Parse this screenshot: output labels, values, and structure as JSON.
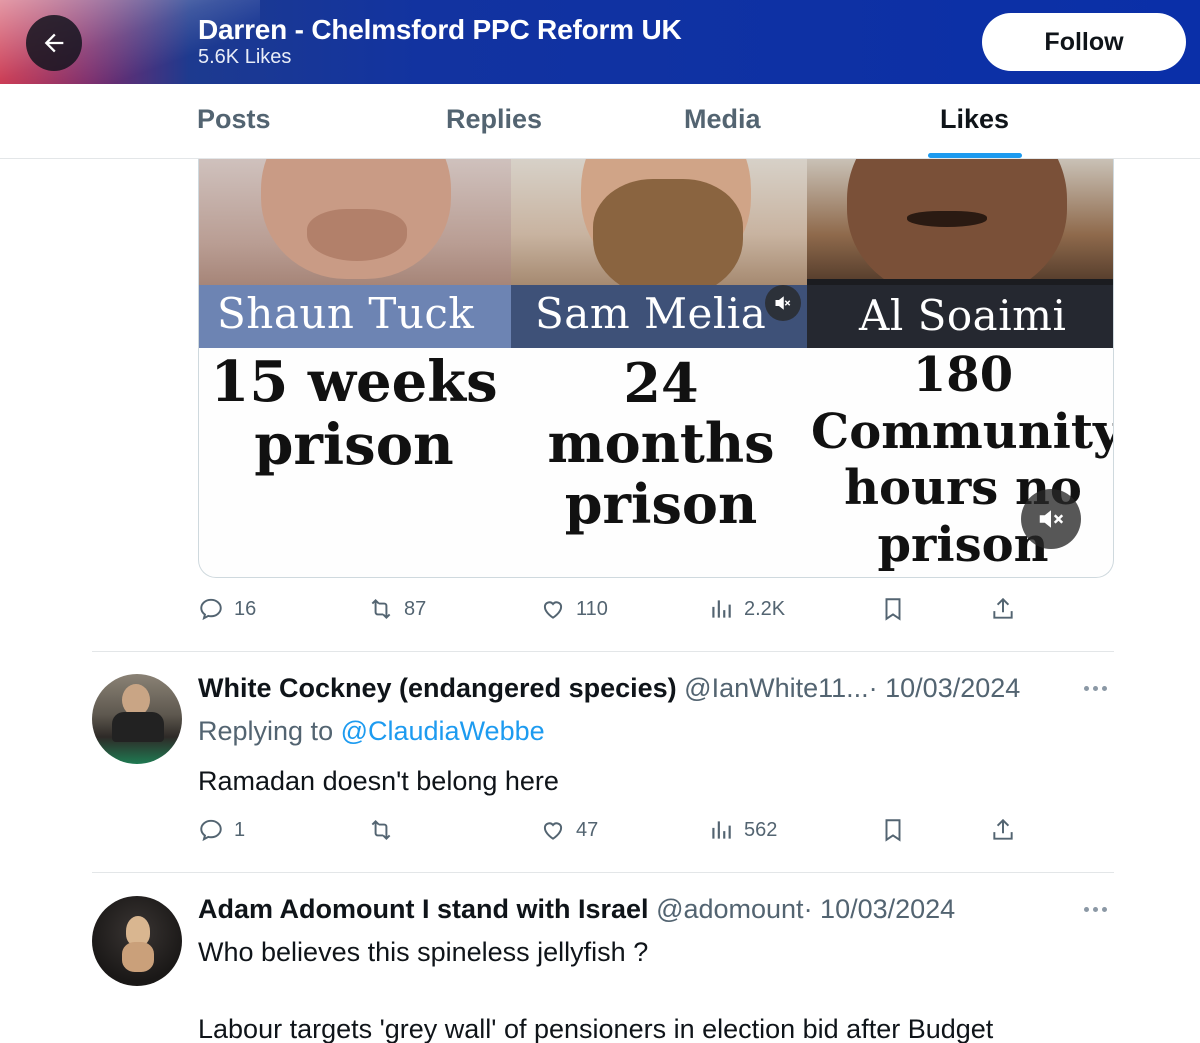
{
  "header": {
    "title": "Darren - Chelmsford PPC Reform UK",
    "subtitle": "5.6K Likes",
    "follow_label": "Follow",
    "back_icon": "arrow-left-icon"
  },
  "tabs": [
    {
      "label": "Posts",
      "active": false
    },
    {
      "label": "Replies",
      "active": false
    },
    {
      "label": "Media",
      "active": false
    },
    {
      "label": "Likes",
      "active": true
    }
  ],
  "media_card": {
    "columns": [
      {
        "name": "Shaun Tuck",
        "name_color": "#ffffff",
        "sentence": [
          "15 weeks",
          "prison"
        ]
      },
      {
        "name": "Sam Melia",
        "name_color": "#ffffff",
        "sentence": [
          "24 months",
          "prison"
        ]
      },
      {
        "name": "Al Soaimi",
        "name_color": "#ffffff",
        "sentence": [
          "180",
          "Community",
          "hours no",
          "prison time"
        ]
      }
    ]
  },
  "tweet1_actions": {
    "replies": "16",
    "reposts": "87",
    "likes": "110",
    "views": "2.2K"
  },
  "tweet2": {
    "name": "White Cockney (endangered species)",
    "handle": "@IanWhite11...",
    "date": "· 10/03/2024",
    "replying_prefix": "Replying to ",
    "replying_to": "@ClaudiaWebbe",
    "text": "Ramadan doesn't belong here",
    "actions": {
      "replies": "1",
      "reposts": "",
      "likes": "47",
      "views": "562"
    }
  },
  "tweet3": {
    "name": "Adam Adomount I stand with Israel",
    "handle": "@adomount",
    "date": "· 10/03/2024",
    "text_line1": "Who believes this spineless jellyfish ?",
    "text_line2": "Labour targets 'grey wall' of pensioners in election bid after Budget"
  },
  "colors": {
    "accent": "#1d9bf0",
    "muted_text": "#536471",
    "header_blue": "#0a2fa8",
    "header_red": "#c41e3a"
  }
}
